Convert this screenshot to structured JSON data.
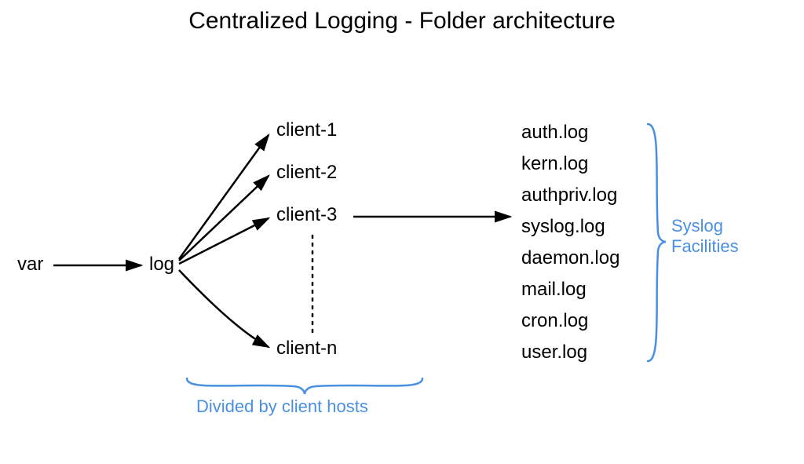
{
  "title": "Centralized Logging - Folder architecture",
  "nodes": {
    "var": "var",
    "log": "log",
    "client1": "client-1",
    "client2": "client-2",
    "client3": "client-3",
    "clientn": "client-n"
  },
  "logs": {
    "auth": "auth.log",
    "kern": "kern.log",
    "authpriv": "authpriv.log",
    "syslog": "syslog.log",
    "daemon": "daemon.log",
    "mail": "mail.log",
    "cron": "cron.log",
    "user": "user.log"
  },
  "annotations": {
    "clients": "Divided by client hosts",
    "facilities_line1": "Syslog",
    "facilities_line2": "Facilities"
  }
}
